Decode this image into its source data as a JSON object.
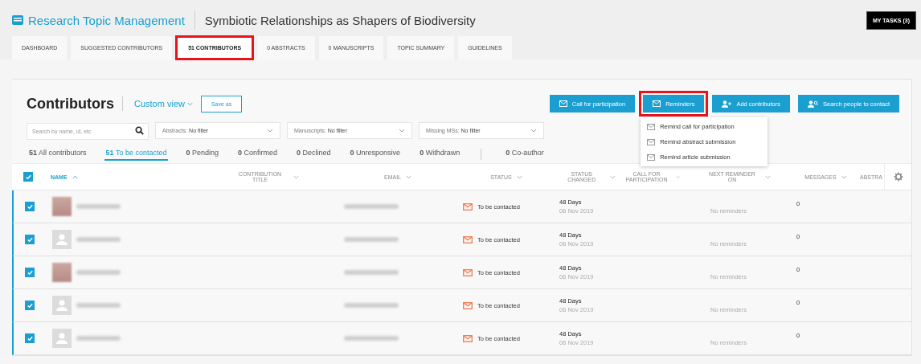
{
  "header": {
    "app_title": "Research Topic Management",
    "topic_title": "Symbiotic Relationships as Shapers of Biodiversity",
    "tasks_button": "MY TASKS (3)"
  },
  "tabs": [
    {
      "label": "DASHBOARD",
      "selected": false,
      "highlighted": false
    },
    {
      "label": "SUGGESTED CONTRIBUTORS",
      "selected": false,
      "highlighted": false
    },
    {
      "label": "51 CONTRIBUTORS",
      "selected": true,
      "highlighted": true
    },
    {
      "label": "0 ABSTRACTS",
      "selected": false,
      "highlighted": false
    },
    {
      "label": "0 MANUSCRIPTS",
      "selected": false,
      "highlighted": false
    },
    {
      "label": "TOPIC SUMMARY",
      "selected": false,
      "highlighted": false
    },
    {
      "label": "GUIDELINES",
      "selected": false,
      "highlighted": false
    }
  ],
  "panel": {
    "title": "Contributors",
    "view_menu": "Custom view",
    "save_button": "Save as"
  },
  "actions": [
    {
      "label": "Call for participation",
      "highlighted": false
    },
    {
      "label": "Reminders",
      "highlighted": true,
      "menu": [
        "Remind call for participation",
        "Remind abstract submission",
        "Remind article submission"
      ]
    },
    {
      "label": "Add contributors",
      "highlighted": false
    },
    {
      "label": "Search people to contact",
      "highlighted": false
    }
  ],
  "search": {
    "placeholder": "Search by name, id, etc"
  },
  "filters": [
    {
      "label": "Abstracts:",
      "value": "No filter"
    },
    {
      "label": "Manuscripts:",
      "value": "No filter"
    },
    {
      "label": "Missing MSs:",
      "value": "No filter"
    }
  ],
  "status_tabs": [
    {
      "count": "51",
      "label": "All contributors",
      "selected": false
    },
    {
      "count": "51",
      "label": "To be contacted",
      "selected": true
    },
    {
      "count": "0",
      "label": "Pending",
      "selected": false
    },
    {
      "count": "0",
      "label": "Confirmed",
      "selected": false
    },
    {
      "count": "0",
      "label": "Declined",
      "selected": false
    },
    {
      "count": "0",
      "label": "Unresponsive",
      "selected": false
    },
    {
      "count": "0",
      "label": "Withdrawn",
      "selected": false
    },
    {
      "count": "0",
      "label": "Co-author",
      "selected": false
    }
  ],
  "table": {
    "all_checked": true,
    "columns": [
      {
        "label": "NAME",
        "sorted": true
      },
      {
        "label": "CONTRIBUTION TITLE",
        "sorted": false
      },
      {
        "label": "EMAIL",
        "sorted": false
      },
      {
        "label": "STATUS",
        "sorted": false
      },
      {
        "label": "STATUS CHANGED",
        "sorted": false
      },
      {
        "label": "CALL FOR PARTICIPATION",
        "sorted": false
      },
      {
        "label": "NEXT REMINDER ON",
        "sorted": false
      },
      {
        "label": "MESSAGES",
        "sorted": false
      },
      {
        "label": "ABSTRA",
        "sorted": false
      }
    ],
    "rows": [
      {
        "checked": true,
        "kind": "photo",
        "status": "To be contacted",
        "changed": "48 Days",
        "changed_date": "06 Nov 2019",
        "next_reminder": "No reminders",
        "messages": "0"
      },
      {
        "checked": true,
        "kind": "silhouette",
        "status": "To be contacted",
        "changed": "48 Days",
        "changed_date": "06 Nov 2019",
        "next_reminder": "No reminders",
        "messages": "0"
      },
      {
        "checked": true,
        "kind": "photo",
        "status": "To be contacted",
        "changed": "48 Days",
        "changed_date": "06 Nov 2019",
        "next_reminder": "No reminders",
        "messages": "0"
      },
      {
        "checked": true,
        "kind": "silhouette",
        "status": "To be contacted",
        "changed": "48 Days",
        "changed_date": "06 Nov 2019",
        "next_reminder": "No reminders",
        "messages": "0"
      },
      {
        "checked": true,
        "kind": "silhouette",
        "status": "To be contacted",
        "changed": "48 Days",
        "changed_date": "06 Nov 2019",
        "next_reminder": "No reminders",
        "messages": "0"
      }
    ]
  }
}
